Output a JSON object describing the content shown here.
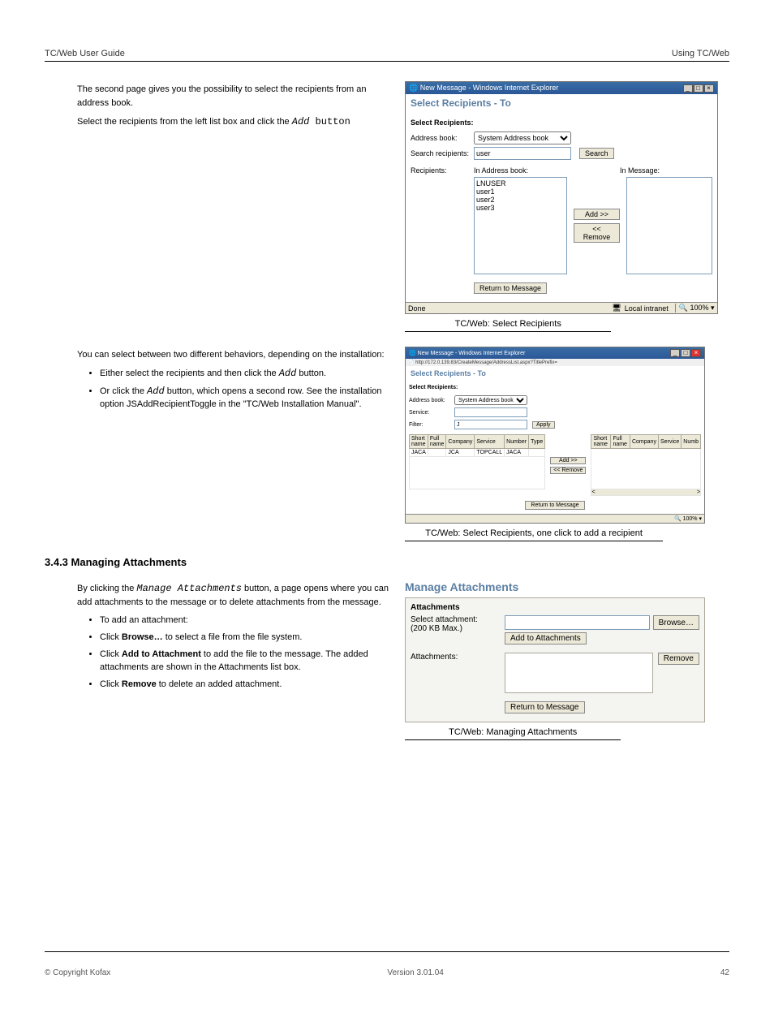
{
  "header": {
    "left": "TC/Web User Guide",
    "right": "Using TC/Web",
    "version": "Version 3.01.04"
  },
  "intro_lines": [
    "The second page gives you the possibility to select the recipients from an address book.",
    "Select the recipients from the left list box and click the"
  ],
  "add_btn_inline": "Add",
  "add_suffix": " button",
  "fig1": {
    "wintitle": "New Message - Windows Internet Explorer",
    "title": "Select Recipients - To",
    "sub": "Select Recipients:",
    "l_addr": "Address book:",
    "l_search": "Search recipients:",
    "sel_addr": "System Address book",
    "inp_search": "user",
    "btn_search": "Search",
    "l_recip": "Recipients:",
    "h_in": "In Address book:",
    "h_msg": "In Message:",
    "list": [
      "LNUSER",
      "user1",
      "user2",
      "user3"
    ],
    "btn_add": "Add >>",
    "btn_rem": "<< Remove",
    "btn_return": "Return to Message",
    "status_done": "Done",
    "zone": "Local intranet",
    "zoom": "100%"
  },
  "caption1": "TC/Web: Select Recipients",
  "dep_head": "You can select between two different behaviors, depending on the installation:",
  "dep_item1": "Either select the recipients and then click the ",
  "dep_item1_btn": "Add",
  "dep_item1_tail": " button.",
  "dep_item2_a": "Or click the ",
  "dep_item2_b": "Add",
  "dep_item2_c": " button, which opens a second row. See the installation option JSAddRecipientToggle in the ",
  "dep_item2_d": "\"TC/Web Installation Manual\"",
  "dep_item2_e": ".",
  "fig2": {
    "wintitle": "New Message - Windows Internet Explorer",
    "url": "http://172.0.139.83/CreateMessage/AddressList.aspx?TitlePrefix=",
    "title": "Select Recipients - To",
    "sub": "Select Recipients:",
    "l_addr": "Address book:",
    "l_service": "Service:",
    "l_filter": "Filter:",
    "sel_addr": "System Address book",
    "inp_filter": "J",
    "btn_apply": "Apply",
    "cols": [
      "Short name",
      "Full name",
      "Company",
      "Service",
      "Number",
      "Type"
    ],
    "cols_r": [
      "Short name",
      "Full name",
      "Company",
      "Service",
      "Numb"
    ],
    "row": {
      "short": "JACA",
      "full": "",
      "company": "JCA",
      "service": "TOPCALL",
      "number": "JACA",
      "type": ""
    },
    "btn_add": "Add >>",
    "btn_rem": "<< Remove",
    "btn_return": "Return to Message",
    "zoom": "100%"
  },
  "caption2": "TC/Web: Select Recipients, one click to add a recipient",
  "attach_h": "3.4.3  Managing Attachments",
  "attach_p1_a": "By clicking the ",
  "attach_p1_b": "Manage Attachments",
  "attach_p1_c": " button, a page opens where you can add attachments to the message or to delete attachments from the message.",
  "attach_list": [
    "To add an attachment:",
    {
      "pre": "Click ",
      "bold": "Browse…",
      "post": " to select a file from the file system."
    },
    {
      "pre": "Click ",
      "bold": "Add to Attachment",
      "post": " to add the file to the message. The added attachments are shown in the Attachments list box."
    },
    {
      "pre": "Click ",
      "bold": "Remove",
      "post": " to delete an added attachment."
    }
  ],
  "fig3": {
    "heading": "Manage Attachments",
    "sub": "Attachments",
    "l_sel": "Select attachment:",
    "l_max": "(200 KB Max.)",
    "btn_browse": "Browse…",
    "btn_add": "Add to Attachments",
    "l_att": "Attachments:",
    "btn_remove": "Remove",
    "btn_return": "Return to Message"
  },
  "caption3": "TC/Web: Managing Attachments",
  "footer": {
    "copyright": "© Copyright Kofax",
    "page": "42"
  }
}
